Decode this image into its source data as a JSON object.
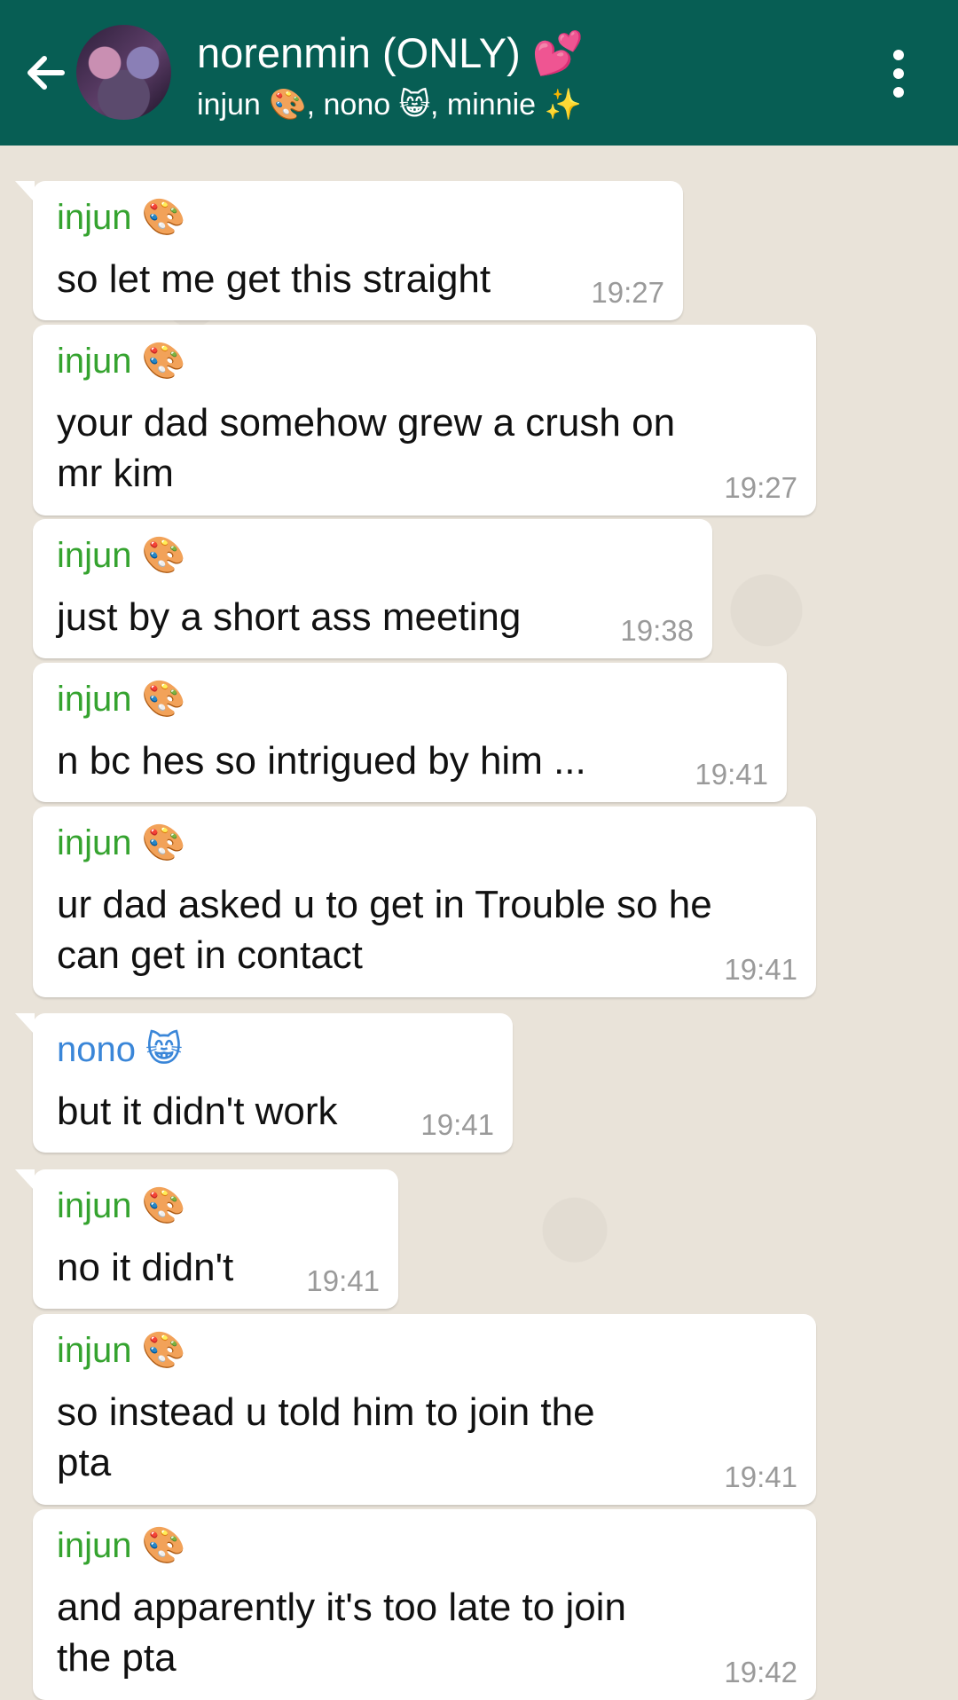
{
  "header": {
    "title": "norenmin (ONLY) 💕",
    "subtitle": "injun 🎨, nono 😸, minnie ✨"
  },
  "messages": [
    {
      "sender": "injun 🎨",
      "text": "so let me get this straight",
      "time": "19:27"
    },
    {
      "sender": "injun 🎨",
      "text": "your dad somehow grew a crush on\nmr kim",
      "time": "19:27"
    },
    {
      "sender": "injun 🎨",
      "text": "just by a short ass meeting",
      "time": "19:38"
    },
    {
      "sender": "injun 🎨",
      "text": "n bc hes so intrigued by him ...",
      "time": "19:41"
    },
    {
      "sender": "injun 🎨",
      "text": "ur dad asked u to get in Trouble so he\ncan get in contact",
      "time": "19:41"
    },
    {
      "sender": "nono 😸",
      "text": "but it didn't work",
      "time": "19:41"
    },
    {
      "sender": "injun 🎨",
      "text": "no it didn't",
      "time": "19:41"
    },
    {
      "sender": "injun 🎨",
      "text": "so instead u told him to join the\npta",
      "time": "19:41"
    },
    {
      "sender": "injun 🎨",
      "text": "and apparently it's too late to join\nthe pta",
      "time": "19:42"
    }
  ],
  "colors": {
    "header_bg": "#075e54",
    "sender_injun": "#35a32f",
    "sender_nono": "#3a86d8",
    "chat_bg": "#e9e3d9"
  },
  "icons": {
    "back": "arrow-left-icon",
    "menu": "more-vertical-icon",
    "avatar": "group-avatar"
  }
}
